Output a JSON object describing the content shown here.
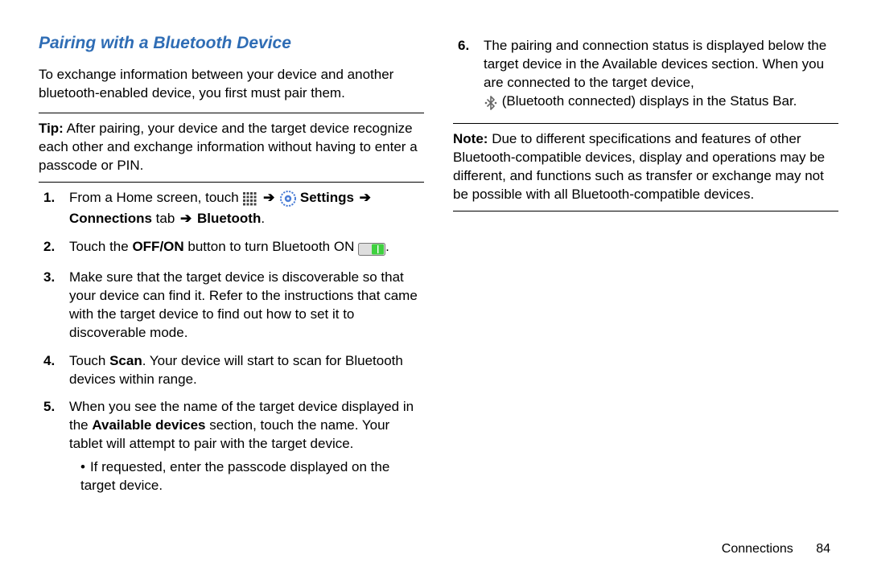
{
  "section_title": "Pairing with a Bluetooth Device",
  "intro": "To exchange information between your device and another bluetooth-enabled device, you first must pair them.",
  "tip_label": "Tip:",
  "tip_text": "After pairing, your device and the target device recognize each other and exchange information without having to enter a passcode or PIN.",
  "arrow": "➔",
  "icons": {
    "apps": "apps-icon",
    "settings": "settings-icon",
    "toggle_on": "toggle-on-icon",
    "bt_connected": "bluetooth-connected-icon"
  },
  "step1": {
    "pre": "From a Home screen, touch ",
    "settings": "Settings",
    "connections_tab": "Connections",
    "tab_word": " tab ",
    "bluetooth": "Bluetooth",
    "period": "."
  },
  "step2": {
    "pre": "Touch the ",
    "offon": "OFF/ON",
    "mid": " button to turn Bluetooth ON ",
    "period": "."
  },
  "step3": "Make sure that the target device is discoverable so that your device can find it. Refer to the instructions that came with the target device to find out how to set it to discoverable mode.",
  "step4": {
    "pre": "Touch ",
    "scan": "Scan",
    "post": ". Your device will start to scan for Bluetooth devices within range."
  },
  "step5": {
    "pre": "When you see the name of the target device displayed in the ",
    "avail": "Available devices",
    "post": " section, touch the name. Your tablet will attempt to pair with the target device.",
    "bullet": "If requested, enter the passcode displayed on the target device."
  },
  "step6": {
    "l1": "The pairing and connection status is displayed below the target device in the Available devices section. When you are connected to the target device,",
    "l2_post": " (Bluetooth connected) displays in the Status Bar."
  },
  "note_label": "Note:",
  "note_text": "Due to different specifications and features of other Bluetooth-compatible devices, display and operations may be different, and functions such as transfer or exchange may not be possible with all Bluetooth-compatible devices.",
  "footer_section": "Connections",
  "footer_page": "84"
}
